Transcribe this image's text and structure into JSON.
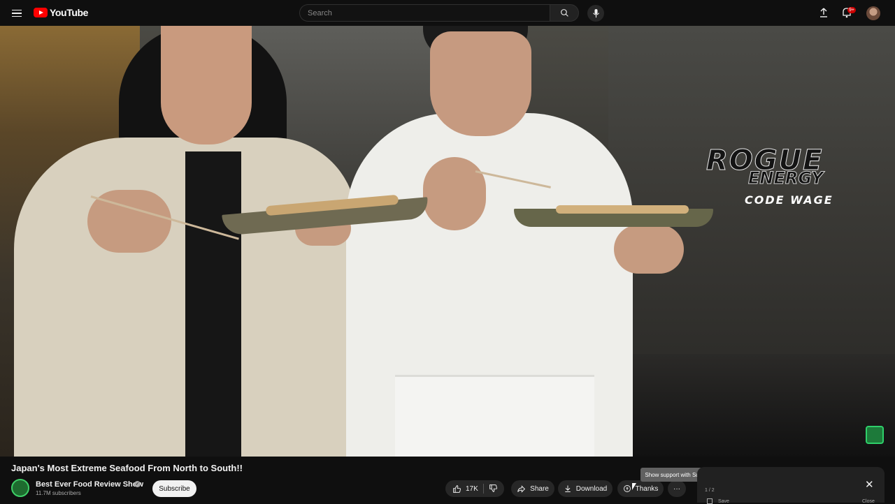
{
  "header": {
    "logo_text": "YouTube",
    "search_placeholder": "Search",
    "notification_badge": "9+",
    "icons": [
      "menu-icon",
      "search-icon",
      "mic-icon",
      "upload-icon",
      "bell-icon",
      "avatar"
    ]
  },
  "video": {
    "overlay": {
      "line1": "ROGUE",
      "line2": "ENERGY",
      "line3": "CODE WAGE"
    }
  },
  "info": {
    "title": "Japan's Most Extreme Seafood From North to South!!",
    "channel_name": "Best Ever Food Review Show",
    "subscribers": "11.7M subscribers",
    "subscribe_label": "Subscribe",
    "like_count": "17K",
    "share_label": "Share",
    "download_label": "Download",
    "thanks_label": "Thanks",
    "more_label": "···",
    "tooltip": "Show support with Super Thanks"
  },
  "panel": {
    "counter": "1 / 2",
    "close_icon": "✕",
    "save_label": "Save",
    "close_label": "Close"
  },
  "colors": {
    "brand_red": "#ff0000",
    "background": "#0f0f0f",
    "pill": "#272727"
  }
}
